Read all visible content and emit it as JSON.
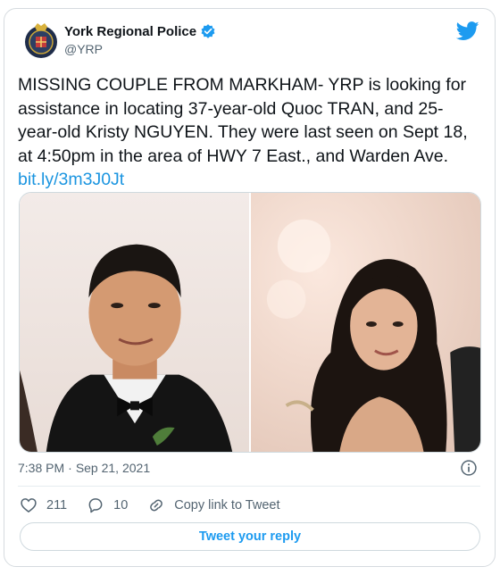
{
  "author": {
    "name": "York Regional Police",
    "handle": "@YRP",
    "verified": true,
    "avatar_icon": "police-crest-icon"
  },
  "tweet": {
    "text": "MISSING COUPLE FROM MARKHAM- YRP is looking for assistance in locating 37-year-old Quoc TRAN, and 25-year-old Kristy NGUYEN. They were last seen on Sept 18, at 4:50pm in the area of HWY 7 East., and Warden Ave. ",
    "link": "bit.ly/3m3J0Jt",
    "time": "7:38 PM",
    "separator": "·",
    "date": "Sep 21, 2021"
  },
  "media": [
    {
      "icon": "man-photo"
    },
    {
      "icon": "woman-photo"
    }
  ],
  "actions": {
    "likes": "211",
    "replies": "10",
    "copy_link": "Copy link to Tweet"
  },
  "reply_button": "Tweet your reply",
  "colors": {
    "accent": "#1d9bf0",
    "link": "#1b95e0",
    "verified": "#1d9bf0"
  }
}
